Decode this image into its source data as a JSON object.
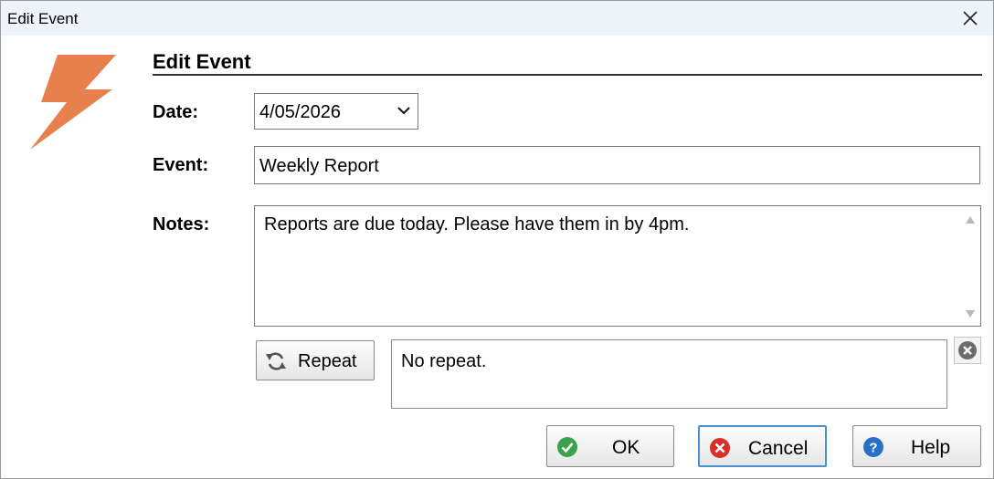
{
  "window": {
    "title": "Edit Event"
  },
  "dialog": {
    "heading": "Edit Event"
  },
  "fields": {
    "date_label": "Date:",
    "date_value": "4/05/2026",
    "event_label": "Event:",
    "event_value": "Weekly Report",
    "notes_label": "Notes:",
    "notes_value": "Reports are due today.  Please have them in by 4pm."
  },
  "repeat": {
    "button_label": "Repeat",
    "summary": "No repeat."
  },
  "buttons": {
    "ok": "OK",
    "cancel": "Cancel",
    "help": "Help"
  },
  "colors": {
    "logo": "#e8804e",
    "ok_icon": "#3aa24a",
    "cancel_icon": "#d9302c",
    "help_icon": "#2a6fc6",
    "focus_border": "#4a90d9"
  },
  "icons": {
    "logo": "lightning-bolt-icon",
    "close": "close-icon",
    "date_dropdown": "chevron-down-icon",
    "repeat": "refresh-icon",
    "clear_repeat": "clear-circle-icon",
    "ok": "check-circle-icon",
    "cancel": "x-circle-icon",
    "help": "question-circle-icon"
  }
}
